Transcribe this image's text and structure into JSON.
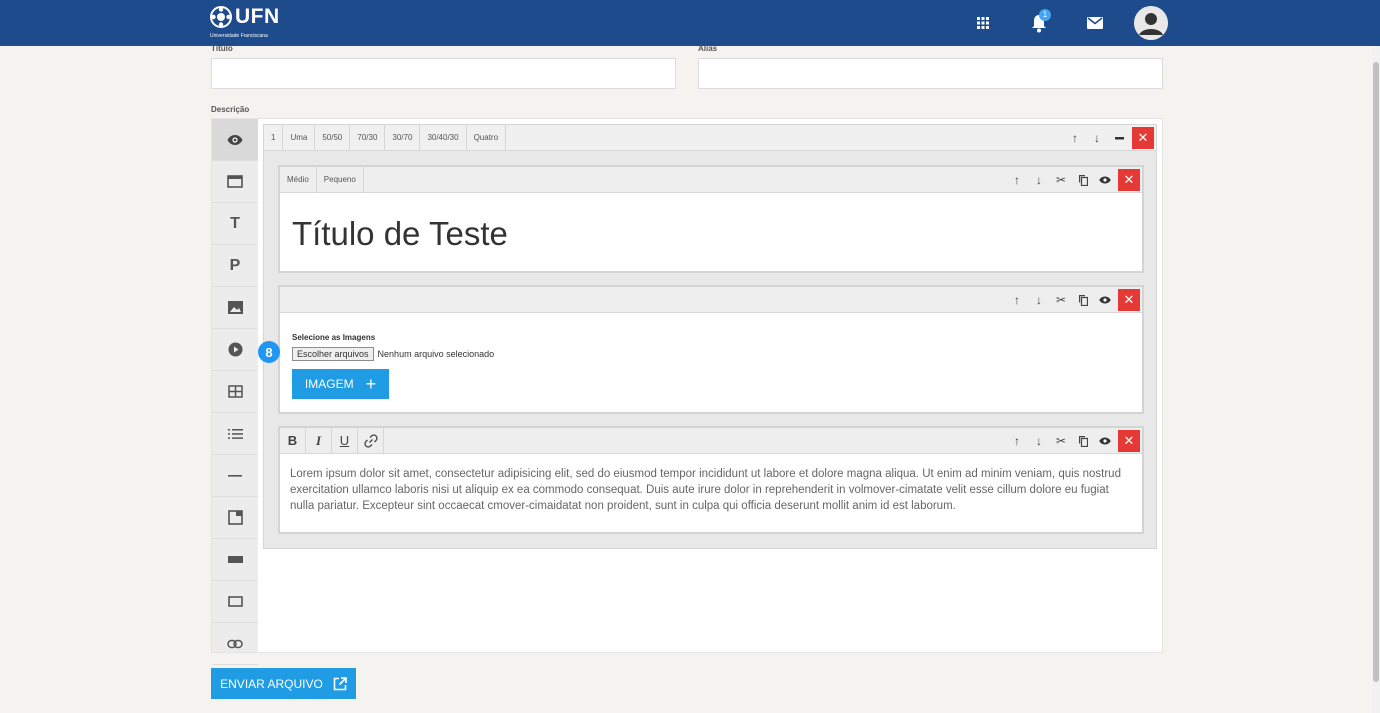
{
  "header": {
    "logo_text": "UFN",
    "logo_sub": "Universidade Franciscana",
    "notification_count": "1",
    "icons": [
      "apps-grid-icon",
      "bell-icon",
      "mail-icon",
      "account-avatar"
    ],
    "background_color": "#1e4b8c"
  },
  "form": {
    "title_label": "Título",
    "title_value": "",
    "alias_label": "Alias",
    "alias_value": "",
    "description_label": "Descrição"
  },
  "sidebar": {
    "items": [
      {
        "name": "preview-eye-icon",
        "glyph": "eye"
      },
      {
        "name": "layout-row-icon",
        "glyph": "row"
      },
      {
        "name": "title-text-icon",
        "glyph": "T"
      },
      {
        "name": "paragraph-icon",
        "glyph": "P"
      },
      {
        "name": "image-icon",
        "glyph": "image"
      },
      {
        "name": "video-play-icon",
        "glyph": "play"
      },
      {
        "name": "table-icon",
        "glyph": "table"
      },
      {
        "name": "list-icon",
        "glyph": "list"
      },
      {
        "name": "divider-icon",
        "glyph": "—"
      },
      {
        "name": "open-in-new-icon",
        "glyph": "box"
      },
      {
        "name": "separator-bar-icon",
        "glyph": "bar"
      },
      {
        "name": "box-frame-icon",
        "glyph": "frame"
      },
      {
        "name": "link-icon",
        "glyph": "link"
      }
    ]
  },
  "row_toolbar": {
    "columns_count": "1",
    "layouts": [
      "Uma",
      "50/50",
      "70/30",
      "30/70",
      "30/40/30",
      "Quatro"
    ]
  },
  "title_block": {
    "sizes": [
      "Médio",
      "Pequeno"
    ],
    "text": "Título de Teste"
  },
  "image_block": {
    "label": "Selecione as Imagens",
    "file_button": "Escolher arquivos",
    "file_status": "Nenhum arquivo selecionado",
    "add_button": "IMAGEM",
    "add_symbol": "+",
    "step_number": "8"
  },
  "text_block": {
    "format_buttons": [
      "B",
      "I",
      "U",
      "link"
    ],
    "content": "Lorem ipsum dolor sit amet, consectetur adipisicing elit, sed do eiusmod tempor incididunt ut labore et dolore magna aliqua. Ut enim ad minim veniam, quis nostrud exercitation ullamco laboris nisi ut aliquip ex ea commodo consequat. Duis aute irure dolor in reprehenderit in volmover-cimatate velit esse cillum dolore eu fugiat nulla pariatur. Excepteur sint occaecat cmover-cimaidatat non proident, sunt in culpa qui officia deserunt mollit anim id est laborum."
  },
  "footer": {
    "send_button": "ENVIAR ARQUIVO"
  },
  "colors": {
    "accent": "#1f9ce4",
    "close": "#e53935",
    "badge": "#2196f3"
  }
}
